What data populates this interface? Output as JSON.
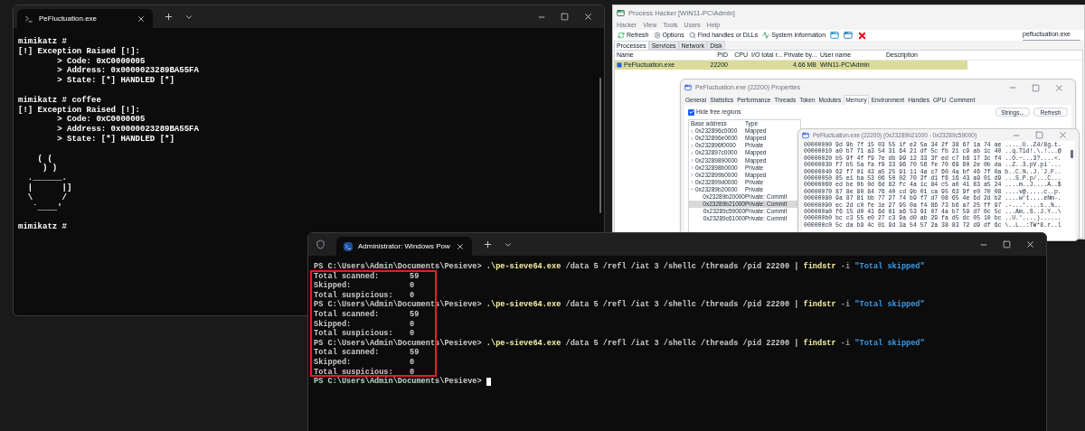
{
  "console_window": {
    "tab_title": "PeFluctuation.exe",
    "blocks": [
      [
        "mimikatz #",
        "[!] Exception Raised [!]:",
        "        > Code: 0xC0000005",
        "        > Address: 0x0000023289BA55FA",
        "        > State: [*] HANDLED [*]"
      ],
      [
        "mimikatz # coffee",
        "[!] Exception Raised [!]:",
        "        > Code: 0xC0000005",
        "        > Address: 0x0000023289BA55FA",
        "        > State: [*] HANDLED [*]"
      ],
      [
        "    ( (",
        "     ) )",
        "  .______.",
        "  |      |]",
        "  \\      /",
        "   `____'"
      ],
      [
        "mimikatz #"
      ]
    ]
  },
  "process_hacker": {
    "title": "Process Hacker [WIN11-PC\\Admin]",
    "menu": [
      "Hacker",
      "View",
      "Tools",
      "Users",
      "Help"
    ],
    "toolbar": [
      {
        "kind": "refresh",
        "label": "Refresh"
      },
      {
        "kind": "options",
        "label": "Options"
      },
      {
        "kind": "find",
        "label": "Find handles or DLLs"
      },
      {
        "kind": "sysinfo",
        "label": "System information"
      },
      {
        "kind": "window"
      },
      {
        "kind": "window-arrow"
      },
      {
        "kind": "cross"
      }
    ],
    "search": {
      "value": "pefluctuation.exe"
    },
    "tabs": [
      {
        "label": "Processes",
        "selected": true
      },
      {
        "label": "Services",
        "selected": false
      },
      {
        "label": "Network",
        "selected": false
      },
      {
        "label": "Disk",
        "selected": false
      }
    ],
    "columns": [
      "Name",
      "PID",
      "CPU",
      "I/O total r...",
      "Private by...",
      "User name",
      "Description"
    ],
    "rows": [
      {
        "name": "PeFluctuation.exe",
        "pid": "22200",
        "private_bytes": "4.66 MB",
        "user": "WIN11-PC\\Admin",
        "color": "#dcdc9a"
      }
    ]
  },
  "properties_window": {
    "title": "PeFluctuation.exe (22200) Properties",
    "tabs": [
      {
        "label": "General",
        "selected": false
      },
      {
        "label": "Statistics",
        "selected": false
      },
      {
        "label": "Performance",
        "selected": false
      },
      {
        "label": "Threads",
        "selected": false
      },
      {
        "label": "Token",
        "selected": false
      },
      {
        "label": "Modules",
        "selected": false
      },
      {
        "label": "Memory",
        "selected": true
      },
      {
        "label": "Environment",
        "selected": false
      },
      {
        "label": "Handles",
        "selected": false
      },
      {
        "label": "GPU",
        "selected": false
      },
      {
        "label": "Comment",
        "selected": false
      }
    ],
    "hide_free_regions": {
      "label": "Hide free regions",
      "checked": true
    },
    "buttons": [
      "Strings...",
      "Refresh"
    ],
    "columns": [
      "Base address",
      "Type"
    ],
    "regions": [
      {
        "address": "0x232896c0000",
        "type": "Mapped",
        "expanded": false,
        "selected": false
      },
      {
        "address": "0x232896e0000",
        "type": "Mapped",
        "expanded": false,
        "selected": false
      },
      {
        "address": "0x232896f0000",
        "type": "Private",
        "expanded": false,
        "selected": false
      },
      {
        "address": "0x232897c0000",
        "type": "Mapped",
        "expanded": false,
        "selected": false
      },
      {
        "address": "0x23289890000",
        "type": "Mapped",
        "expanded": false,
        "selected": false
      },
      {
        "address": "0x232898b0000",
        "type": "Private",
        "expanded": false,
        "selected": false
      },
      {
        "address": "0x232899b0000",
        "type": "Mapped",
        "expanded": false,
        "selected": false
      },
      {
        "address": "0x232899d0000",
        "type": "Private",
        "expanded": false,
        "selected": false
      },
      {
        "address": "0x23289b20000",
        "type": "Private",
        "expanded": true,
        "selected": false,
        "children": [
          {
            "address": "0x23289b20000",
            "type": "Private: Commit",
            "selected": false
          },
          {
            "address": "0x23289b21000",
            "type": "Private: Commit",
            "selected": true
          },
          {
            "address": "0x23289c59000",
            "type": "Private: Commit",
            "selected": false
          },
          {
            "address": "0x23289c61000",
            "type": "Private: Commit",
            "selected": false
          }
        ]
      }
    ]
  },
  "hex_window": {
    "title": "PeFluctuation.exe (22200) (0x23289b21000 - 0x23289c59000)",
    "lines": [
      "00000000 9d 9b 7f 15 03 55 1f e2 5a 34 2f 38 67 1a 74 ae .....U..Z4/8g.t.",
      "00000010 a0 b7 71 a3 54 31 64 21 df 5c fb 21 c9 ab 1c 40 ..q.T1d!.\\.!...@",
      "00000020 b5 9f 4f f9 7e db 99 12 33 3f ed c7 b6 17 3c f4 ..O.~...3?....<.",
      "00000030 f7 b5 5a fa f9 33 96 70 56 fe 70 69 60 2e 0b da ..Z..3.pV.pi`...",
      "00000040 62 f7 01 43 a5 25 91 11 4a c7 60 4a bf 46 7f 0a b..C.%..J.`J.F..",
      "00000050 85 e1 ba 53 06 50 02 70 2f d1 f6 16 43 a9 01 d9 ...S.P.p/...C...",
      "00000060 ed be 0b 0d 6d 82 fc 4a 1c 84 c5 a0 41 83 a5 24 ....m..J....A..$",
      "00000070 87 8e 80 84 76 40 cd 9b 01 ca 95 63 9f e0 70 08 ....v@.....c..p.",
      "00000080 9a 87 81 bb 77 27 74 b9 f7 d7 08 65 4e 6d 2d b2 ....w't....eNm-.",
      "00000090 ec 2d c0 fe 1e 27 95 0a f4 86 73 b6 a7 25 ff 97 .-...'....s..%..",
      "000000a0 f6 15 d0 41 6d 81 a6 53 91 07 4a b7 59 d7 0c 5c ...Am..S..J.Y..\\",
      "000000b0 bc c3 55 e0 27 c3 9a d0 ab 29 fa d5 dc 05 10 bc ..U.'....)......",
      "000000c0 5c da b9 4c 01 9d 3a 54 57 2a 38 83 72 d9 df 6c \\..L..:TW*8.r..l"
    ]
  },
  "powershell_window": {
    "tab_title": "Administrator: Windows Pow",
    "highlight_box": true,
    "lines": [
      {
        "kind": "prompt",
        "prompt": "PS C:\\Users\\Admin\\Documents\\Pesieve>",
        "tokens": [
          {
            "kind": "command",
            "text": ".\\pe-sieve64.exe"
          },
          {
            "kind": "arg",
            "text": "/data 5 /refl /iat 3 /shellc /threads /pid 22200 |"
          },
          {
            "kind": "command",
            "text": "findstr"
          },
          {
            "kind": "flag",
            "text": "-i"
          },
          {
            "kind": "string",
            "text": "\"Total skipped\""
          }
        ]
      },
      {
        "kind": "output",
        "label": "Total scanned:",
        "value": "59"
      },
      {
        "kind": "output",
        "label": "Skipped:",
        "value": "0"
      },
      {
        "kind": "output",
        "label": "Total suspicious:",
        "value": "0"
      },
      {
        "kind": "prompt",
        "prompt": "PS C:\\Users\\Admin\\Documents\\Pesieve>",
        "tokens": [
          {
            "kind": "command",
            "text": ".\\pe-sieve64.exe"
          },
          {
            "kind": "arg",
            "text": "/data 5 /refl /iat 3 /shellc /threads /pid 22200 |"
          },
          {
            "kind": "command",
            "text": "findstr"
          },
          {
            "kind": "flag",
            "text": "-i"
          },
          {
            "kind": "string",
            "text": "\"Total skipped\""
          }
        ]
      },
      {
        "kind": "output",
        "label": "Total scanned:",
        "value": "59"
      },
      {
        "kind": "output",
        "label": "Skipped:",
        "value": "0"
      },
      {
        "kind": "output",
        "label": "Total suspicious:",
        "value": "0"
      },
      {
        "kind": "prompt",
        "prompt": "PS C:\\Users\\Admin\\Documents\\Pesieve>",
        "tokens": [
          {
            "kind": "command",
            "text": ".\\pe-sieve64.exe"
          },
          {
            "kind": "arg",
            "text": "/data 5 /refl /iat 3 /shellc /threads /pid 22200 |"
          },
          {
            "kind": "command",
            "text": "findstr"
          },
          {
            "kind": "flag",
            "text": "-i"
          },
          {
            "kind": "string",
            "text": "\"Total skipped\""
          }
        ]
      },
      {
        "kind": "output",
        "label": "Total scanned:",
        "value": "59"
      },
      {
        "kind": "output",
        "label": "Skipped:",
        "value": "0"
      },
      {
        "kind": "output",
        "label": "Total suspicious:",
        "value": "0"
      },
      {
        "kind": "prompt",
        "prompt": "PS C:\\Users\\Admin\\Documents\\Pesieve>",
        "cursor": true
      }
    ]
  }
}
